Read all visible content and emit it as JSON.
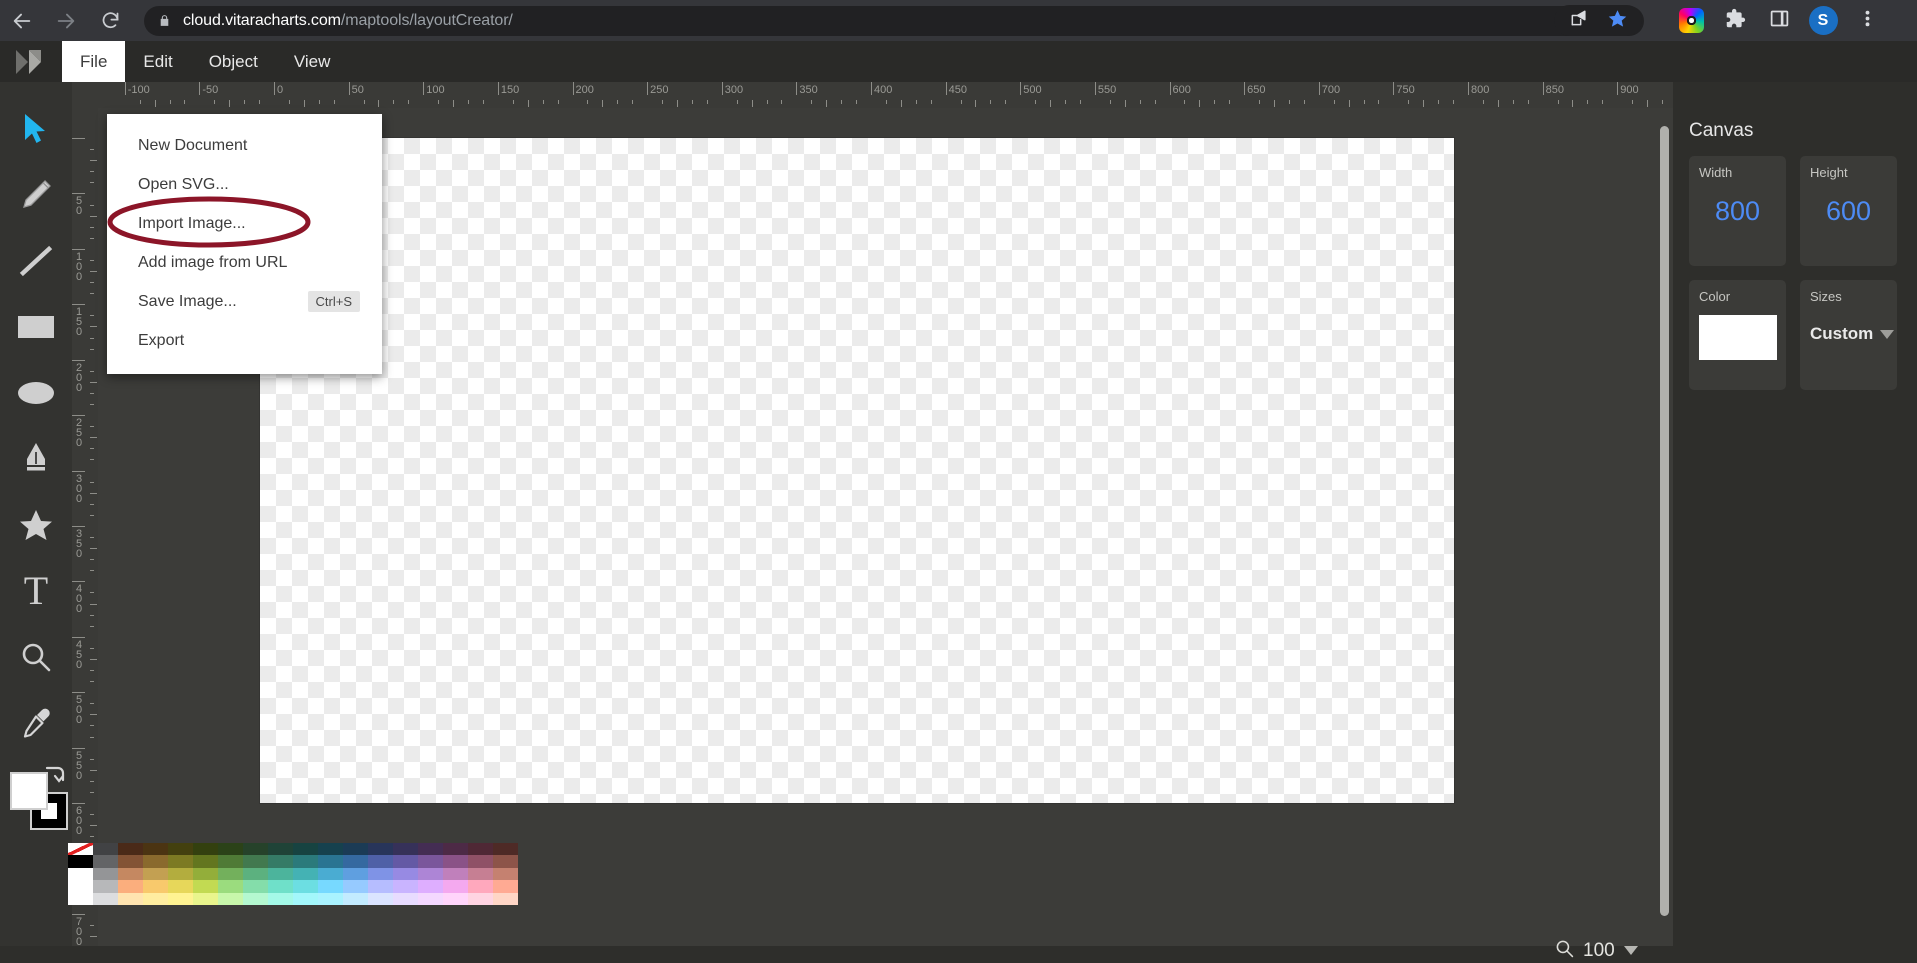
{
  "browser": {
    "back_icon": "back-arrow-icon",
    "forward_icon": "forward-arrow-icon",
    "reload_icon": "reload-icon",
    "lock_icon": "lock-icon",
    "url_domain": "cloud.vitaracharts.com",
    "url_path": "/maptools/layoutCreator/",
    "share_icon": "share-icon",
    "bookmark_icon": "star-bookmark-icon",
    "screenshot_ext_icon": "camera-extension-icon",
    "extensions_icon": "puzzle-piece-icon",
    "sidepanel_icon": "side-panel-icon",
    "avatar_initial": "S",
    "menu_icon": "three-dot-menu-icon"
  },
  "app": {
    "logo_icon": "app-logo-icon",
    "menus": [
      {
        "label": "File",
        "active": true
      },
      {
        "label": "Edit",
        "active": false
      },
      {
        "label": "Object",
        "active": false
      },
      {
        "label": "View",
        "active": false
      }
    ],
    "file_menu": {
      "items": [
        {
          "label": "New Document",
          "shortcut": ""
        },
        {
          "label": "Open SVG...",
          "shortcut": ""
        },
        {
          "label": "Import Image...",
          "shortcut": "",
          "annotated": true
        },
        {
          "label": "Add image from URL",
          "shortcut": ""
        },
        {
          "label": "Save Image...",
          "shortcut": "Ctrl+S"
        },
        {
          "label": "Export",
          "shortcut": ""
        }
      ],
      "annotation_color": "#8c1528"
    }
  },
  "toolbar": {
    "tools": [
      {
        "name": "select-tool",
        "icon": "cursor-arrow-icon",
        "active": true
      },
      {
        "name": "pencil-tool",
        "icon": "pencil-icon",
        "active": false
      },
      {
        "name": "line-tool",
        "icon": "line-icon",
        "active": false
      },
      {
        "name": "rectangle-tool",
        "icon": "rectangle-icon",
        "active": false
      },
      {
        "name": "ellipse-tool",
        "icon": "ellipse-icon",
        "active": false
      },
      {
        "name": "pen-tool",
        "icon": "pen-nib-icon",
        "active": false
      },
      {
        "name": "star-tool",
        "icon": "star-icon",
        "active": false
      },
      {
        "name": "text-tool",
        "icon": "text-t-icon",
        "active": false
      },
      {
        "name": "zoom-tool",
        "icon": "magnifier-icon",
        "active": false
      },
      {
        "name": "eyedropper-tool",
        "icon": "eyedropper-icon",
        "active": false
      }
    ],
    "foreground_color": "#ffffff",
    "background_color": "#000000",
    "swap_icon": "swap-colors-icon"
  },
  "rulers": {
    "horizontal_ticks": [
      -100,
      -50,
      0,
      50,
      100,
      150,
      200,
      250,
      300,
      350,
      400,
      450,
      500,
      550,
      600,
      650,
      700,
      750,
      800,
      850,
      900
    ],
    "vertical_ticks": [
      50,
      100,
      150,
      200,
      250,
      300,
      350,
      400,
      450,
      500,
      550
    ],
    "unit_step": 50
  },
  "canvas_panel": {
    "title": "Canvas",
    "width_label": "Width",
    "width_value": "800",
    "height_label": "Height",
    "height_value": "600",
    "color_label": "Color",
    "color_value": "#ffffff",
    "sizes_label": "Sizes",
    "sizes_value": "Custom",
    "dropdown_icon": "chevron-down-icon",
    "accent_color": "#4d8bf5"
  },
  "statusbar": {
    "zoom_icon": "magnifier-icon",
    "zoom_value": "100",
    "zoom_dropdown_icon": "chevron-down-icon"
  },
  "palette": {
    "none_swatch": "no-color-swatch",
    "grayscale": [
      "#ffffff",
      "#000000",
      "#ffffff",
      "#ffffff",
      "#ffffff"
    ],
    "rows": [
      [
        "#414244",
        "#4a2a18",
        "#4b3412",
        "#43400f",
        "#33400f",
        "#2b4218",
        "#26422a",
        "#1f4337",
        "#174341",
        "#16414e",
        "#1b3b55",
        "#28355a",
        "#363159",
        "#442d53",
        "#4d2a46",
        "#4f2835",
        "#4e2a26"
      ],
      [
        "#636466",
        "#835335",
        "#8a6a2d",
        "#7c7a23",
        "#63761f",
        "#4f7a36",
        "#42794f",
        "#357b66",
        "#2b7a7b",
        "#2a7492",
        "#3569a0",
        "#4f60a7",
        "#6459a5",
        "#7a569b",
        "#8a5287",
        "#8f5166",
        "#8d5449"
      ],
      [
        "#949597",
        "#c58861",
        "#c3a052",
        "#b3ad3e",
        "#93ae3a",
        "#73b05c",
        "#5cb17f",
        "#4cb49c",
        "#44b2b4",
        "#4aacd2",
        "#5f9fe0",
        "#7f93e6",
        "#978ae3",
        "#ad85d6",
        "#c080bb",
        "#c67f93",
        "#c58170"
      ],
      [
        "#b7b8ba",
        "#fbae7d",
        "#f8c96c",
        "#e7d75a",
        "#c2da52",
        "#9bdc7e",
        "#84ddaa",
        "#6fe0c9",
        "#6cdee2",
        "#77d9ff",
        "#96caff",
        "#b6bdff",
        "#c9b4ff",
        "#deaeff",
        "#f4a9ef",
        "#ffa8bd",
        "#ffaa93"
      ],
      [
        "#dcdddf",
        "#ffe4b0",
        "#ffeda0",
        "#fff392",
        "#e9f58d",
        "#c8f7ab",
        "#b4f8d0",
        "#a4f9e8",
        "#a3f7fb",
        "#aaf3ff",
        "#c3ebff",
        "#dbe4ff",
        "#e8dcff",
        "#f4d8ff",
        "#ffd5fb",
        "#ffd4e2",
        "#ffd6c6"
      ]
    ]
  }
}
